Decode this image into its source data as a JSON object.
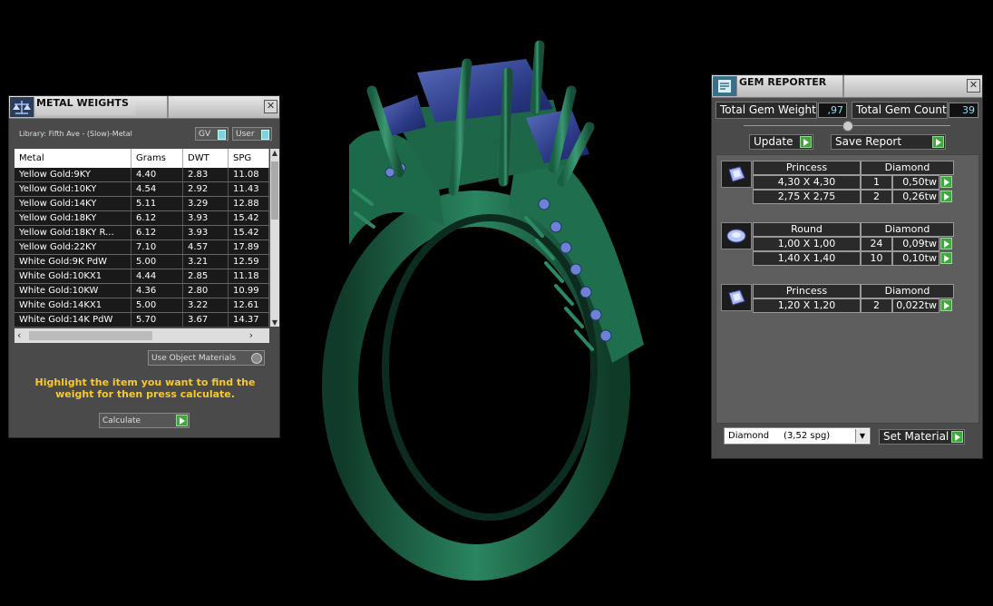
{
  "metal": {
    "title": "METAL WEIGHTS",
    "library": "Library: Fifth Ave - (Slow)-Metal",
    "toggle_gv": "GV",
    "toggle_user": "User",
    "columns": [
      "Metal",
      "Grams",
      "DWT",
      "SPG"
    ],
    "rows": [
      [
        "Yellow Gold:9KY",
        "4.40",
        "2.83",
        "11.08"
      ],
      [
        "Yellow Gold:10KY",
        "4.54",
        "2.92",
        "11.43"
      ],
      [
        "Yellow Gold:14KY",
        "5.11",
        "3.29",
        "12.88"
      ],
      [
        "Yellow Gold:18KY",
        "6.12",
        "3.93",
        "15.42"
      ],
      [
        "Yellow Gold:18KY R...",
        "6.12",
        "3.93",
        "15.42"
      ],
      [
        "Yellow Gold:22KY",
        "7.10",
        "4.57",
        "17.89"
      ],
      [
        "White Gold:9K PdW",
        "5.00",
        "3.21",
        "12.59"
      ],
      [
        "White Gold:10KX1",
        "4.44",
        "2.85",
        "11.18"
      ],
      [
        "White Gold:10KW",
        "4.36",
        "2.80",
        "10.99"
      ],
      [
        "White Gold:14KX1",
        "5.00",
        "3.22",
        "12.61"
      ],
      [
        "White Gold:14K PdW",
        "5.70",
        "3.67",
        "14.37"
      ]
    ],
    "use_object_materials": "Use Object Materials",
    "hint": "Highlight the item you want to find the weight for then press calculate.",
    "calculate": "Calculate"
  },
  "gem": {
    "title": "GEM REPORTER",
    "total_weight_label": "Total Gem Weight",
    "total_weight_value": ",97",
    "total_count_label": "Total Gem Count",
    "total_count_value": "39",
    "update": "Update",
    "save_report": "Save Report",
    "groups": [
      {
        "shape": "Princess",
        "material": "Diamond",
        "rows": [
          [
            "4,30 X 4,30",
            "1",
            "0,50tw"
          ],
          [
            "2,75 X 2,75",
            "2",
            "0,26tw"
          ]
        ]
      },
      {
        "shape": "Round",
        "material": "Diamond",
        "rows": [
          [
            "1,00 X 1,00",
            "24",
            "0,09tw"
          ],
          [
            "1,40 X 1,40",
            "10",
            "0,10tw"
          ]
        ]
      },
      {
        "shape": "Princess",
        "material": "Diamond",
        "rows": [
          [
            "1,20 X 1,20",
            "2",
            "0,022tw"
          ]
        ]
      }
    ],
    "material_select": "Diamond     (3,52 spg)",
    "set_material": "Set Material"
  },
  "colors": {
    "ring_metal": "#1f6b4c",
    "gem_blue": "#2f3f8a",
    "hint_yellow": "#f7c92e",
    "accent_green": "#3ea83c"
  },
  "icons": {
    "metal_panel": "scale-icon",
    "gem_panel": "report-icon"
  }
}
